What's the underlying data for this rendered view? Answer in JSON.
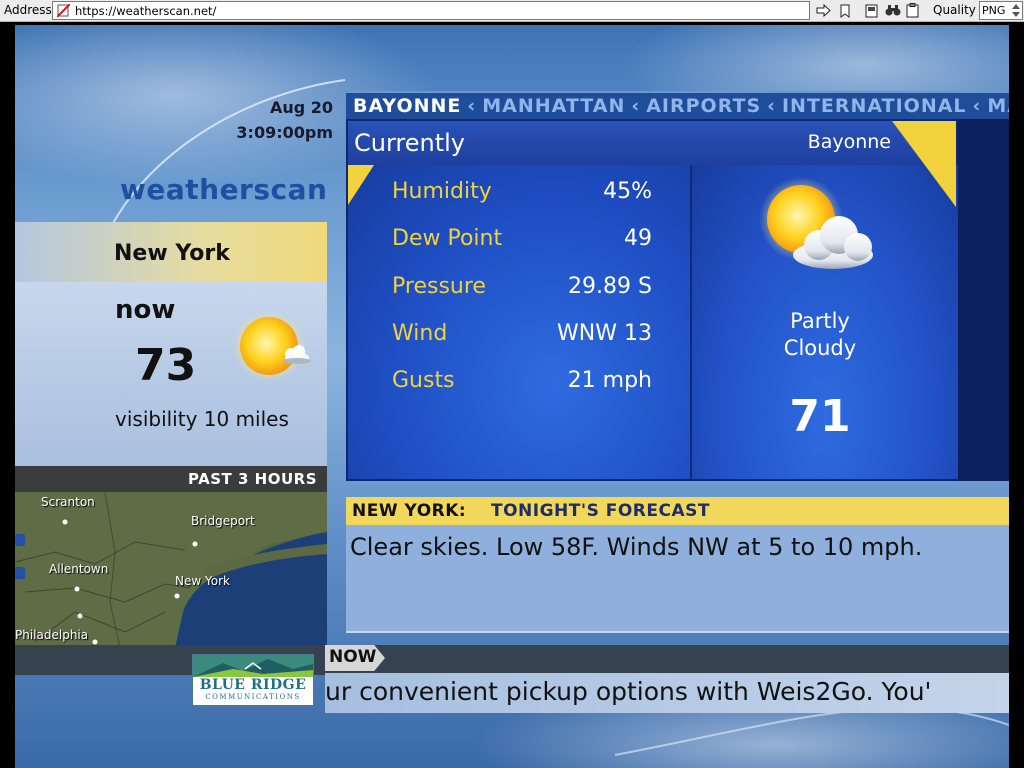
{
  "browser": {
    "address_label": "Address",
    "url": "https://weatherscan.net/",
    "quality_label": "Quality",
    "format": "PNG"
  },
  "header": {
    "date": "Aug 20",
    "time": "3:09:00pm",
    "logo": "weatherscan"
  },
  "local": {
    "city": "New York",
    "now_label": "now",
    "temp": "73",
    "visibility": "visibility 10 miles",
    "icon": "sun-with-small-cloud-icon"
  },
  "radar": {
    "title": "PAST 3 HOURS",
    "labels": [
      "Scranton",
      "Bridgeport",
      "Allentown",
      "New York",
      "Philadelphia"
    ]
  },
  "ticker": {
    "active": "BAYONNE",
    "items": [
      "MANHATTAN",
      "AIRPORTS",
      "INTERNATIONAL",
      "MANH"
    ],
    "separator": "‹"
  },
  "current": {
    "title": "Currently",
    "location": "Bayonne",
    "observations": [
      {
        "label": "Humidity",
        "value": "45%"
      },
      {
        "label": "Dew Point",
        "value": "49"
      },
      {
        "label": "Pressure",
        "value": "29.89 S"
      },
      {
        "label": "Wind",
        "value": "WNW 13"
      },
      {
        "label": "Gusts",
        "value": "21 mph"
      }
    ],
    "condition": "Partly Cloudy",
    "temp": "71",
    "icon": "partly-cloudy-icon"
  },
  "forecast": {
    "city": "NEW YORK:",
    "title": "TONIGHT'S FORECAST",
    "text": "Clear skies. Low 58F. Winds NW at 5 to 10 mph."
  },
  "crawl": {
    "tag": "NOW",
    "text": "ur convenient pickup options with Weis2Go. You'",
    "sponsor_name": "BLUE RIDGE",
    "sponsor_sub": "COMMUNICATIONS"
  },
  "colors": {
    "label_yellow": "#f2d23c",
    "panel_blue": "#1d3fa8",
    "forecast_yellow": "#f1d75a",
    "logo_blue": "#1e4fa0"
  }
}
